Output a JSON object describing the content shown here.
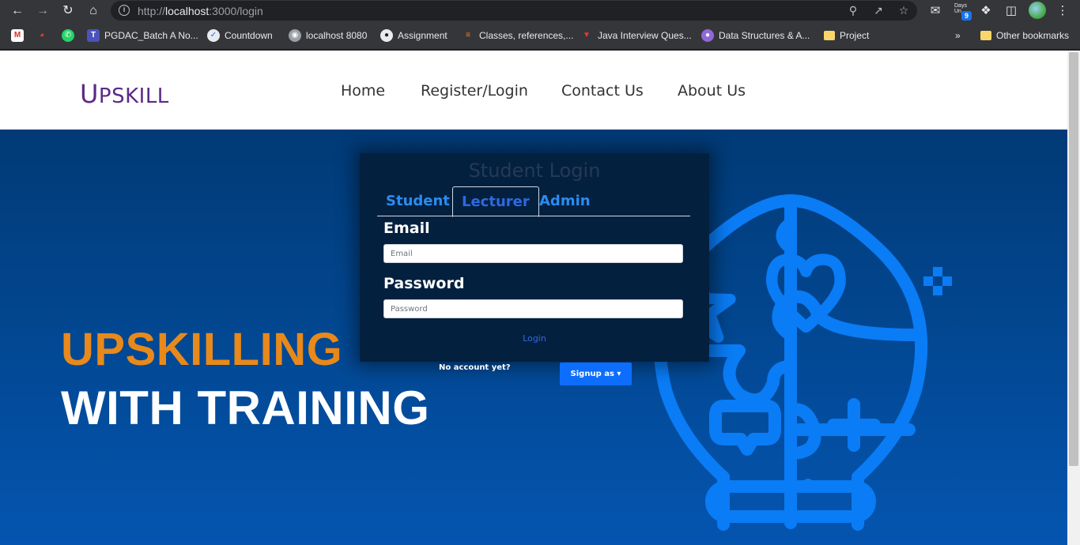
{
  "browser": {
    "url_scheme": "http://",
    "url_host": "localhost",
    "url_rest": ":3000/login",
    "days_extension_label": "Days Un",
    "days_badge": "9",
    "bookmarks": [
      {
        "label": "",
        "icon": "gmail-icon"
      },
      {
        "label": "",
        "icon": "speedometer-icon"
      },
      {
        "label": "",
        "icon": "whatsapp-icon"
      },
      {
        "label": "PGDAC_Batch A No...",
        "icon": "teams-icon"
      },
      {
        "label": "Countdown",
        "icon": "countdown-icon"
      },
      {
        "label": "localhost 8080",
        "icon": "globe-icon"
      },
      {
        "label": "Assignment",
        "icon": "github-icon"
      },
      {
        "label": "Classes, references,...",
        "icon": "stackoverflow-icon"
      },
      {
        "label": "Java Interview Ques...",
        "icon": "java-icon"
      },
      {
        "label": "Data Structures & A...",
        "icon": "ds-icon"
      },
      {
        "label": "Project",
        "icon": "folder-icon"
      }
    ],
    "overflow_label": "»",
    "other_bookmarks": "Other bookmarks"
  },
  "site": {
    "brand_first": "U",
    "brand_rest": "PSKILL",
    "nav": [
      "Home",
      "Register/Login",
      "Contact Us",
      "About Us"
    ],
    "hero_line_1": "UPSKILLING",
    "hero_line_2": "WITH TRAINING"
  },
  "login": {
    "title": "Student Login",
    "tabs": [
      "Student",
      "Lecturer",
      "Admin"
    ],
    "active_tab": "Lecturer",
    "email_label": "Email",
    "email_placeholder": "Email",
    "password_label": "Password",
    "password_placeholder": "Password",
    "login_link": "Login",
    "no_account": "No account yet?",
    "signup_button": "Signup as"
  },
  "colors": {
    "brand": "#5b2a86",
    "hero_accent": "#e8891b",
    "primary": "#0d6efd",
    "hero_bg": "#02468f"
  }
}
